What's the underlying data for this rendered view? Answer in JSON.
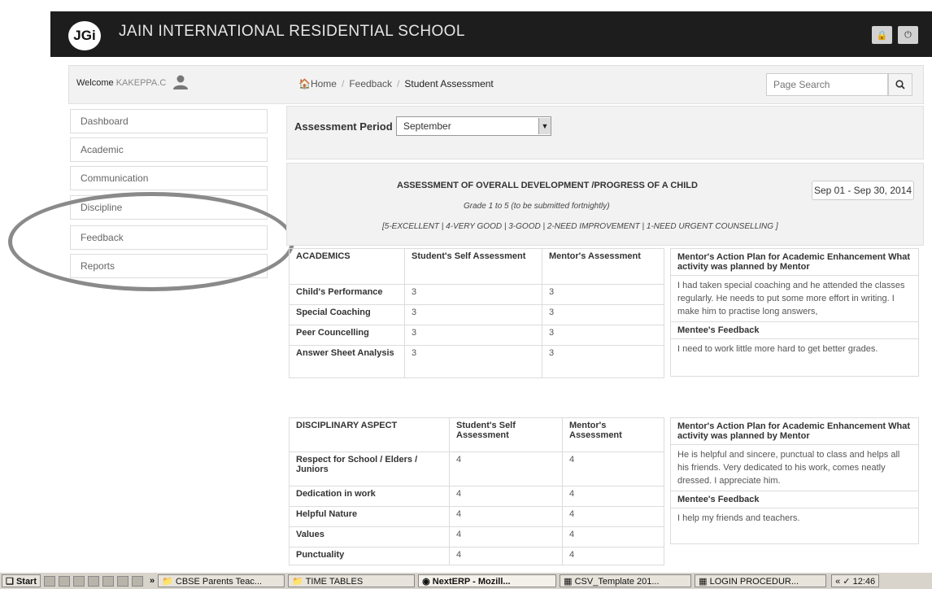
{
  "header": {
    "logo_text": "JGi",
    "school_name": "JAIN INTERNATIONAL RESIDENTIAL SCHOOL",
    "lock_icon": "lock-icon",
    "power_icon": "power-icon"
  },
  "welcome": {
    "prefix": "Welcome",
    "user": "KAKEPPA.C"
  },
  "breadcrumb": {
    "home": "Home",
    "feedback": "Feedback",
    "current": "Student Assessment"
  },
  "search": {
    "placeholder": "Page Search"
  },
  "sidebar": {
    "items": [
      {
        "label": "Dashboard"
      },
      {
        "label": "Academic"
      },
      {
        "label": "Communication"
      },
      {
        "label": "Discipline"
      },
      {
        "label": "Feedback"
      },
      {
        "label": "Reports"
      }
    ]
  },
  "period": {
    "label": "Assessment Period",
    "selected": "September"
  },
  "assessment": {
    "title": "ASSESSMENT OF OVERALL DEVELOPMENT /PROGRESS OF A CHILD",
    "subtitle": "Grade 1 to 5 (to be submitted fortnightly)",
    "scale": "[5-EXCELLENT | 4-VERY GOOD | 3-GOOD | 2-NEED IMPROVEMENT | 1-NEED URGENT COUNSELLING ]",
    "date_range": "Sep 01 - Sep 30, 2014"
  },
  "academics": {
    "headers": [
      "ACADEMICS",
      "Student's Self Assessment",
      "Mentor's Assessment"
    ],
    "rows": [
      {
        "label": "Child's Performance",
        "self": "3",
        "mentor": "3"
      },
      {
        "label": "Special Coaching",
        "self": "3",
        "mentor": "3"
      },
      {
        "label": "Peer Councelling",
        "self": "3",
        "mentor": "3"
      },
      {
        "label": "Answer Sheet Analysis",
        "self": "3",
        "mentor": "3"
      }
    ],
    "plan_title": "Mentor's Action Plan for Academic Enhancement What activity was planned by Mentor",
    "plan_text": "I had taken special coaching and he attended the classes regularly. He needs to put some more effort in writing. I make him to practise long answers,",
    "feedback_title": "Mentee's Feedback",
    "feedback_text": "I need to work little more hard to get better grades."
  },
  "discipline": {
    "headers": [
      "DISCIPLINARY ASPECT",
      "Student's Self Assessment",
      "Mentor's Assessment"
    ],
    "rows": [
      {
        "label": "Respect for School / Elders / Juniors",
        "self": "4",
        "mentor": "4"
      },
      {
        "label": "Dedication in work",
        "self": "4",
        "mentor": "4"
      },
      {
        "label": "Helpful Nature",
        "self": "4",
        "mentor": "4"
      },
      {
        "label": "Values",
        "self": "4",
        "mentor": "4"
      },
      {
        "label": "Punctuality",
        "self": "4",
        "mentor": "4"
      }
    ],
    "plan_title": "Mentor's Action Plan for Academic Enhancement What activity was planned by Mentor",
    "plan_text": "He is helpful and sincere, punctual to class and helps all his friends. Very dedicated to his work, comes neatly dressed. I appreciate him.",
    "feedback_title": "Mentee's Feedback",
    "feedback_text": "I help my friends and teachers."
  },
  "taskbar": {
    "start": "Start",
    "chevron": "»",
    "items": [
      "CBSE Parents Teac...",
      "TIME TABLES",
      "NextERP - Mozill...",
      "CSV_Template 201...",
      "LOGIN PROCEDUR..."
    ],
    "tray_arrows": "«",
    "clock": "12:46"
  }
}
